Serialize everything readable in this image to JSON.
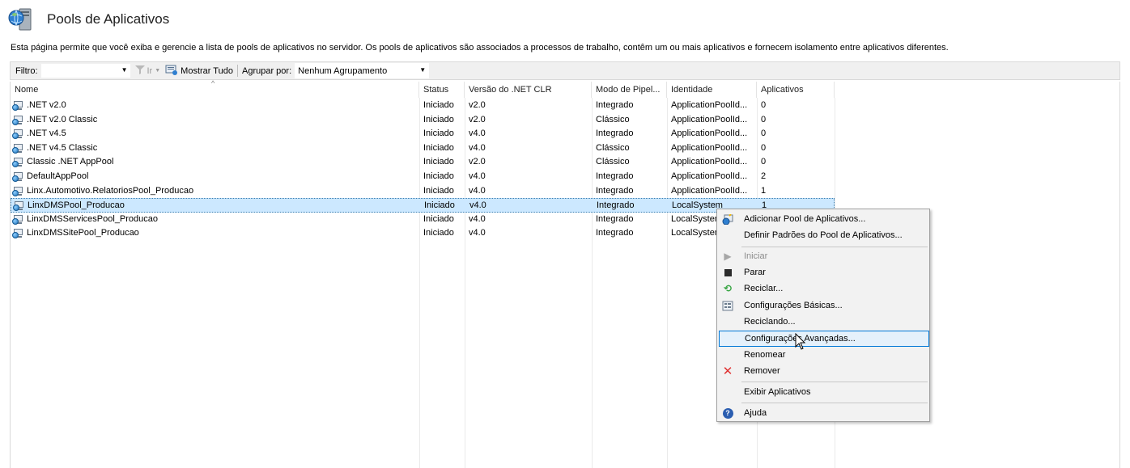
{
  "header": {
    "title": "Pools de Aplicativos",
    "icon": "server-globe-icon"
  },
  "description": "Esta página permite que você exiba e gerencie a lista de pools de aplicativos no servidor. Os pools de aplicativos são associados a processos de trabalho, contêm um ou mais aplicativos e fornecem isolamento entre aplicativos diferentes.",
  "toolbar": {
    "filter_label": "Filtro:",
    "filter_value": "",
    "go_label": "Ir",
    "show_all_label": "Mostrar Tudo",
    "group_label": "Agrupar por:",
    "group_value": "Nenhum Agrupamento"
  },
  "columns": [
    "Nome",
    "Status",
    "Versão do .NET CLR",
    "Modo de Pipel...",
    "Identidade",
    "Aplicativos"
  ],
  "rows": [
    {
      "name": ".NET v2.0",
      "status": "Iniciado",
      "clr": "v2.0",
      "pipeline": "Integrado",
      "identity": "ApplicationPoolId...",
      "apps": "0"
    },
    {
      "name": ".NET v2.0 Classic",
      "status": "Iniciado",
      "clr": "v2.0",
      "pipeline": "Clássico",
      "identity": "ApplicationPoolId...",
      "apps": "0"
    },
    {
      "name": ".NET v4.5",
      "status": "Iniciado",
      "clr": "v4.0",
      "pipeline": "Integrado",
      "identity": "ApplicationPoolId...",
      "apps": "0"
    },
    {
      "name": ".NET v4.5 Classic",
      "status": "Iniciado",
      "clr": "v4.0",
      "pipeline": "Clássico",
      "identity": "ApplicationPoolId...",
      "apps": "0"
    },
    {
      "name": "Classic .NET AppPool",
      "status": "Iniciado",
      "clr": "v2.0",
      "pipeline": "Clássico",
      "identity": "ApplicationPoolId...",
      "apps": "0"
    },
    {
      "name": "DefaultAppPool",
      "status": "Iniciado",
      "clr": "v4.0",
      "pipeline": "Integrado",
      "identity": "ApplicationPoolId...",
      "apps": "2"
    },
    {
      "name": "Linx.Automotivo.RelatoriosPool_Producao",
      "status": "Iniciado",
      "clr": "v4.0",
      "pipeline": "Integrado",
      "identity": "ApplicationPoolId...",
      "apps": "1"
    },
    {
      "name": "LinxDMSPool_Producao",
      "status": "Iniciado",
      "clr": "v4.0",
      "pipeline": "Integrado",
      "identity": "LocalSystem",
      "apps": "1",
      "selected": true
    },
    {
      "name": "LinxDMSServicesPool_Producao",
      "status": "Iniciado",
      "clr": "v4.0",
      "pipeline": "Integrado",
      "identity": "LocalSystem",
      "apps": ""
    },
    {
      "name": "LinxDMSSitePool_Producao",
      "status": "Iniciado",
      "clr": "v4.0",
      "pipeline": "Integrado",
      "identity": "LocalSystem",
      "apps": ""
    }
  ],
  "context_menu": {
    "items": [
      {
        "label": "Adicionar Pool de Aplicativos...",
        "icon": "add-pool-icon"
      },
      {
        "label": "Definir Padrões do Pool de Aplicativos...",
        "icon": ""
      },
      {
        "label": "Iniciar",
        "icon": "play-icon",
        "disabled": true
      },
      {
        "label": "Parar",
        "icon": "stop-icon"
      },
      {
        "label": "Reciclar...",
        "icon": "recycle-icon"
      },
      {
        "label": "Configurações Básicas...",
        "icon": "settings-icon"
      },
      {
        "label": "Reciclando...",
        "icon": ""
      },
      {
        "label": "Configurações Avançadas...",
        "icon": "",
        "hover": true
      },
      {
        "label": "Renomear",
        "icon": ""
      },
      {
        "label": "Remover",
        "icon": "remove-icon"
      },
      {
        "label": "Exibir Aplicativos",
        "icon": ""
      },
      {
        "label": "Ajuda",
        "icon": "help-icon"
      }
    ]
  },
  "colors": {
    "selection": "#cce8ff",
    "hover_border": "#0078d7",
    "remove": "#e03131",
    "recycle": "#3aa645"
  }
}
